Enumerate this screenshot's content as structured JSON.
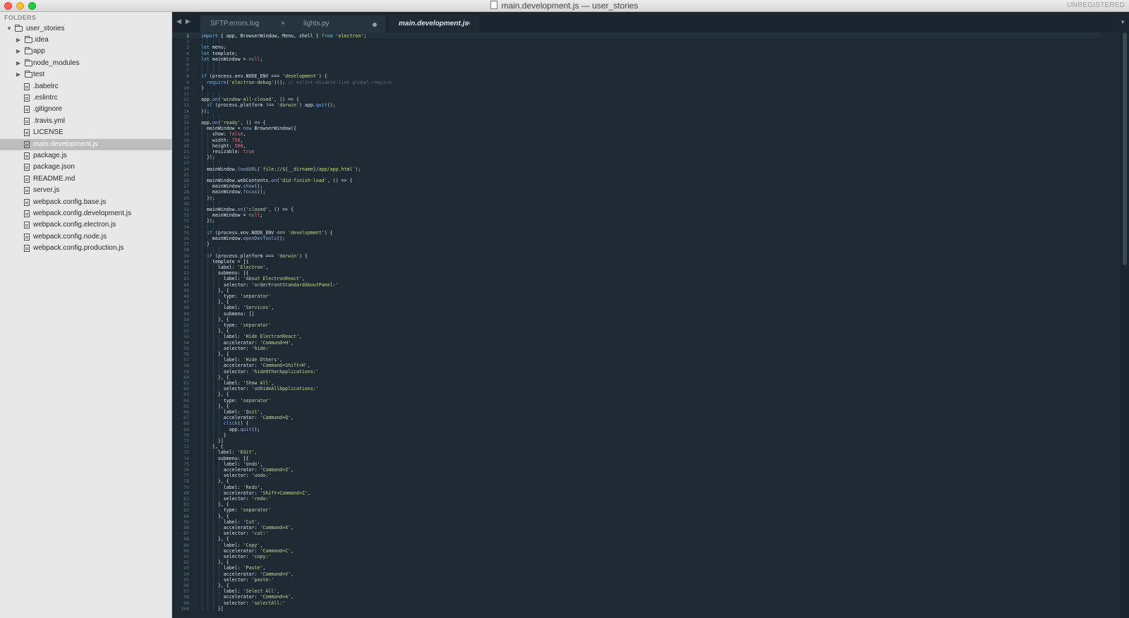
{
  "window": {
    "title": "main.development.js — user_stories",
    "unregistered": "UNREGISTERED"
  },
  "sidebar": {
    "header": "FOLDERS",
    "items": [
      {
        "label": "user_stories",
        "kind": "folder-open",
        "depth": 0
      },
      {
        "label": ".idea",
        "kind": "folder",
        "depth": 1
      },
      {
        "label": "app",
        "kind": "folder",
        "depth": 1
      },
      {
        "label": "node_modules",
        "kind": "folder",
        "depth": 1
      },
      {
        "label": "test",
        "kind": "folder",
        "depth": 1
      },
      {
        "label": ".babelrc",
        "kind": "file",
        "depth": 1
      },
      {
        "label": ".eslintrc",
        "kind": "file",
        "depth": 1
      },
      {
        "label": ".gitignore",
        "kind": "file",
        "depth": 1
      },
      {
        "label": ".travis.yml",
        "kind": "file",
        "depth": 1
      },
      {
        "label": "LICENSE",
        "kind": "file",
        "depth": 1
      },
      {
        "label": "main.development.js",
        "kind": "file",
        "depth": 1,
        "selected": true
      },
      {
        "label": "package.js",
        "kind": "file",
        "depth": 1
      },
      {
        "label": "package.json",
        "kind": "file",
        "depth": 1
      },
      {
        "label": "README.md",
        "kind": "file",
        "depth": 1
      },
      {
        "label": "server.js",
        "kind": "file",
        "depth": 1
      },
      {
        "label": "webpack.config.base.js",
        "kind": "file",
        "depth": 1
      },
      {
        "label": "webpack.config.development.js",
        "kind": "file",
        "depth": 1
      },
      {
        "label": "webpack.config.electron.js",
        "kind": "file",
        "depth": 1
      },
      {
        "label": "webpack.config.node.js",
        "kind": "file",
        "depth": 1
      },
      {
        "label": "webpack.config.production.js",
        "kind": "file",
        "depth": 1
      }
    ]
  },
  "tabs": [
    {
      "label": "SFTP.errors.log",
      "state": "close"
    },
    {
      "label": "lights.py",
      "state": "modified"
    },
    {
      "label": "main.development.js",
      "state": "close",
      "active": true
    }
  ],
  "icons": {
    "close": "×",
    "back": "◀",
    "forward": "▶",
    "tab_menu": "▼"
  },
  "editor": {
    "current_line": 1,
    "lines": [
      "import { app, BrowserWindow, Menu, shell } from 'electron';",
      "",
      "let menu;",
      "let template;",
      "let mainWindow = null;",
      "",
      "",
      "if (process.env.NODE_ENV === 'development') {",
      "  require('electron-debug')(); // eslint-disable-line global-require",
      "}",
      "",
      "app.on('window-all-closed', () => {",
      "  if (process.platform !== 'darwin') app.quit();",
      "});",
      "",
      "app.on('ready', () => {",
      "  mainWindow = new BrowserWindow({",
      "    show: false,",
      "    width: 750,",
      "    height: 500,",
      "    resizable: true",
      "  });",
      "",
      "  mainWindow.loadURL(`file://${__dirname}/app/app.html`);",
      "",
      "  mainWindow.webContents.on('did-finish-load', () => {",
      "    mainWindow.show();",
      "    mainWindow.focus();",
      "  });",
      "",
      "  mainWindow.on('closed', () => {",
      "    mainWindow = null;",
      "  });",
      "",
      "  if (process.env.NODE_ENV === 'development') {",
      "    mainWindow.openDevTools();",
      "  }",
      "",
      "  if (process.platform === 'darwin') {",
      "    template = [{",
      "      label: 'Electron',",
      "      submenu: [{",
      "        label: 'About ElectronReact',",
      "        selector: 'orderFrontStandardAboutPanel:'",
      "      }, {",
      "        type: 'separator'",
      "      }, {",
      "        label: 'Services',",
      "        submenu: []",
      "      }, {",
      "        type: 'separator'",
      "      }, {",
      "        label: 'Hide ElectronReact',",
      "        accelerator: 'Command+H',",
      "        selector: 'hide:'",
      "      }, {",
      "        label: 'Hide Others',",
      "        accelerator: 'Command+Shift+H',",
      "        selector: 'hideOtherApplications:'",
      "      }, {",
      "        label: 'Show All',",
      "        selector: 'unhideAllApplications:'",
      "      }, {",
      "        type: 'separator'",
      "      }, {",
      "        label: 'Quit',",
      "        accelerator: 'Command+Q',",
      "        click() {",
      "          app.quit();",
      "        }",
      "      }]",
      "    }, {",
      "      label: 'Edit',",
      "      submenu: [{",
      "        label: 'Undo',",
      "        accelerator: 'Command+Z',",
      "        selector: 'undo:'",
      "      }, {",
      "        label: 'Redo',",
      "        accelerator: 'Shift+Command+Z',",
      "        selector: 'redo:'",
      "      }, {",
      "        type: 'separator'",
      "      }, {",
      "        label: 'Cut',",
      "        accelerator: 'Command+X',",
      "        selector: 'cut:'",
      "      }, {",
      "        label: 'Copy',",
      "        accelerator: 'Command+C',",
      "        selector: 'copy:'",
      "      }, {",
      "        label: 'Paste',",
      "        accelerator: 'Command+V',",
      "        selector: 'paste:'",
      "      }, {",
      "        label: 'Select All',",
      "        accelerator: 'Command+A',",
      "        selector: 'selectAll:'",
      "      }]"
    ]
  },
  "colors": {
    "editor_bg": "#1d2a33",
    "sidebar_bg": "#e8e8e8",
    "sidebar_selected": "#bdbdbd",
    "string": "#c3d88a",
    "keyword": "#6fb3e0",
    "comment": "#5c6f7b"
  }
}
